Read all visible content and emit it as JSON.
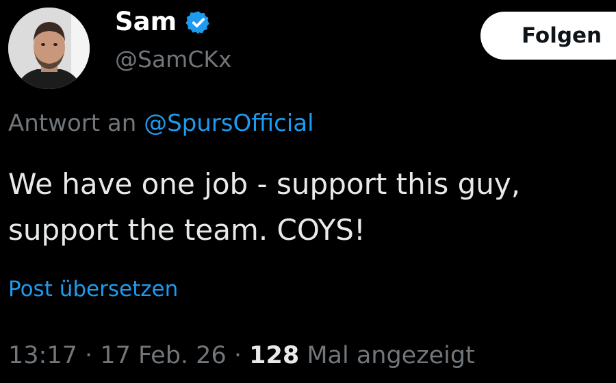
{
  "author": {
    "display_name": "Sam",
    "handle": "@SamCKx",
    "verified_icon": "verified-badge-icon",
    "avatar_icon": "user-avatar-photo"
  },
  "follow_button": {
    "label": "Folgen"
  },
  "reply": {
    "prefix": "Antwort an",
    "target": "@SpursOfficial"
  },
  "tweet": {
    "text_line1": "We have one job - support this guy,",
    "text_line2": "support the team. COYS!"
  },
  "translate": {
    "label": "Post übersetzen"
  },
  "meta": {
    "time": "13:17",
    "separator": "·",
    "date": "17 Feb. 26",
    "views_count": "128",
    "views_label": "Mal angezeigt"
  },
  "colors": {
    "background": "#000000",
    "primary_text": "#e7e9ea",
    "secondary_text": "#71767b",
    "accent": "#1d9bf0",
    "follow_button_bg": "#ffffff",
    "follow_button_text": "#0f1419"
  }
}
